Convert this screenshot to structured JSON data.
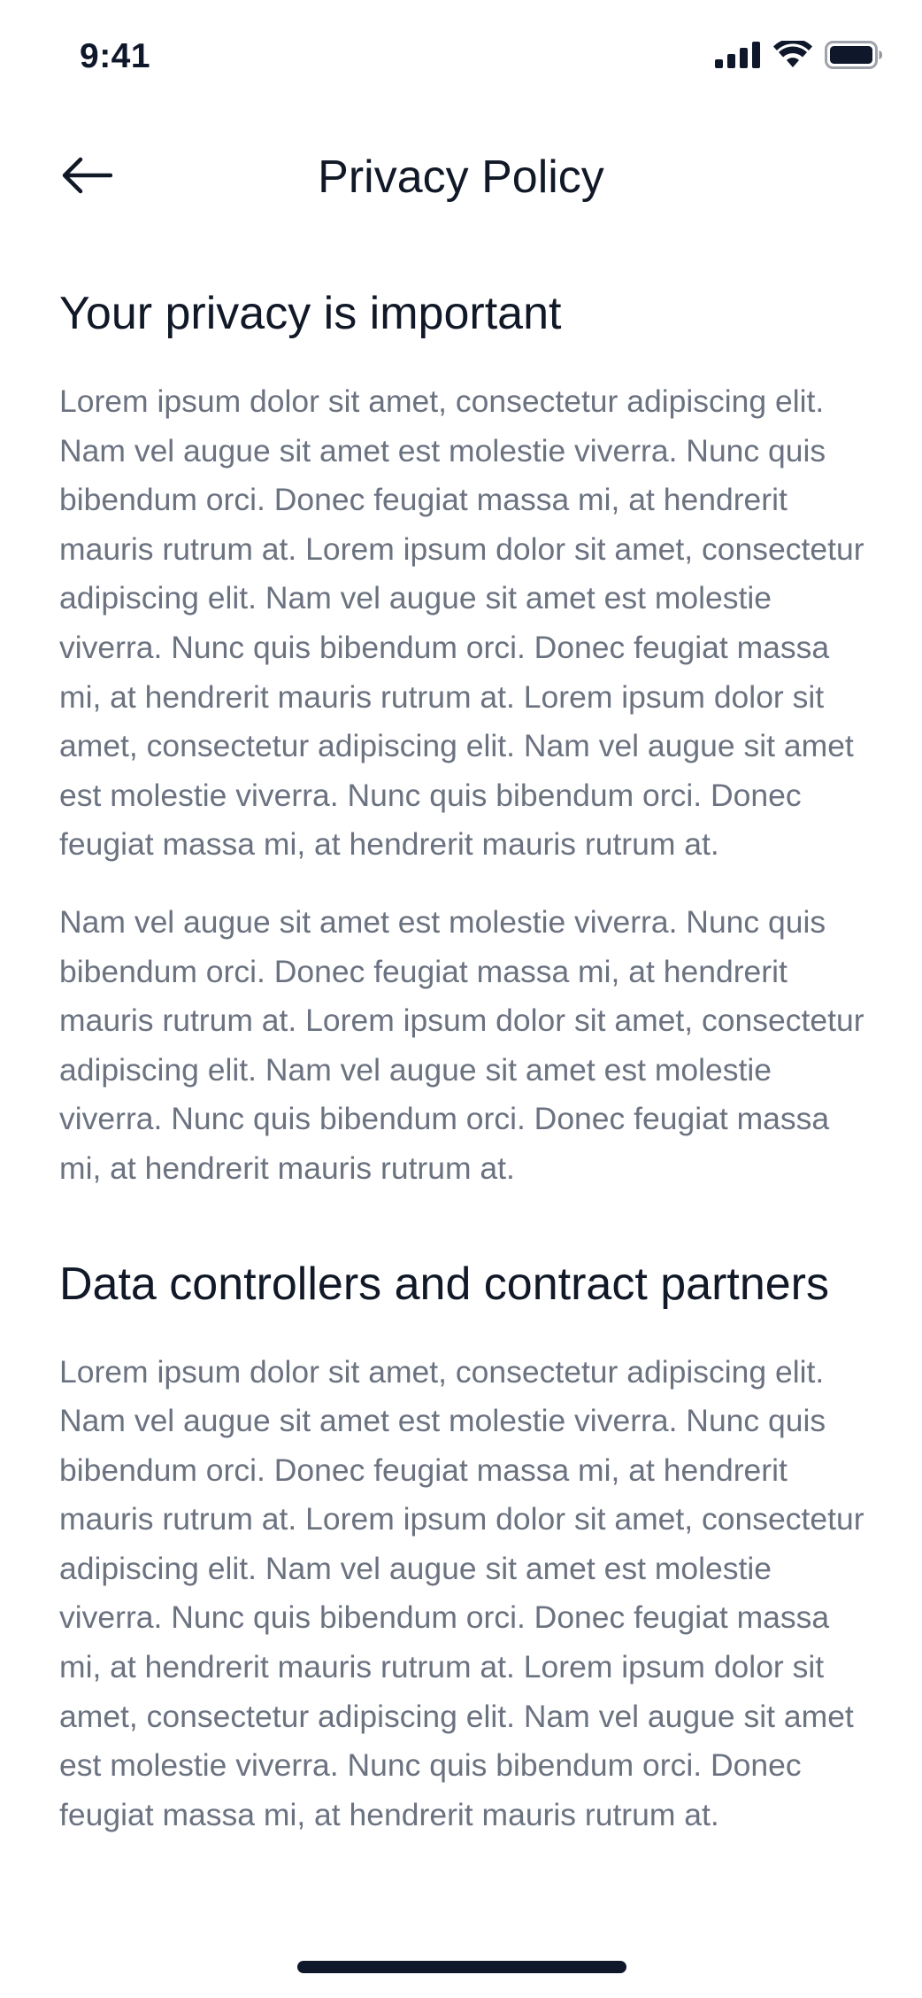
{
  "status_bar": {
    "time": "9:41",
    "icons": [
      "cellular-signal-icon",
      "wifi-icon",
      "battery-icon"
    ]
  },
  "header": {
    "title": "Privacy Policy",
    "back_icon": "arrow-left-icon"
  },
  "sections": [
    {
      "heading": "Your privacy is important",
      "paragraphs": [
        "Lorem ipsum dolor sit amet, consectetur adipiscing elit. Nam vel augue sit amet est molestie viverra. Nunc quis bibendum orci. Donec feugiat massa mi, at hendrerit mauris rutrum at. Lorem ipsum dolor sit amet, consectetur adipiscing elit. Nam vel augue sit amet est molestie viverra. Nunc quis bibendum orci. Donec feugiat massa mi, at hendrerit mauris rutrum at. Lorem ipsum dolor sit amet, consectetur adipiscing elit. Nam vel augue sit amet est molestie viverra. Nunc quis bibendum orci. Donec feugiat massa mi, at hendrerit mauris rutrum at.",
        "Nam vel augue sit amet est molestie viverra. Nunc quis bibendum orci. Donec feugiat massa mi, at hendrerit mauris rutrum at. Lorem ipsum dolor sit amet, consectetur adipiscing elit. Nam vel augue sit amet est molestie viverra. Nunc quis bibendum orci. Donec feugiat massa mi, at hendrerit mauris rutrum at."
      ]
    },
    {
      "heading": "Data controllers and contract partners",
      "paragraphs": [
        "Lorem ipsum dolor sit amet, consectetur adipiscing elit. Nam vel augue sit amet est molestie viverra. Nunc quis bibendum orci. Donec feugiat massa mi, at hendrerit mauris rutrum at. Lorem ipsum dolor sit amet, consectetur adipiscing elit. Nam vel augue sit amet est molestie viverra. Nunc quis bibendum orci. Donec feugiat massa mi, at hendrerit mauris rutrum at. Lorem ipsum dolor sit amet, consectetur adipiscing elit. Nam vel augue sit amet est molestie viverra. Nunc quis bibendum orci. Donec feugiat massa mi, at hendrerit mauris rutrum at."
      ]
    }
  ],
  "colors": {
    "text_primary": "#111827",
    "text_secondary": "#6b7280",
    "home_indicator": "#0f172a",
    "background": "#ffffff"
  }
}
